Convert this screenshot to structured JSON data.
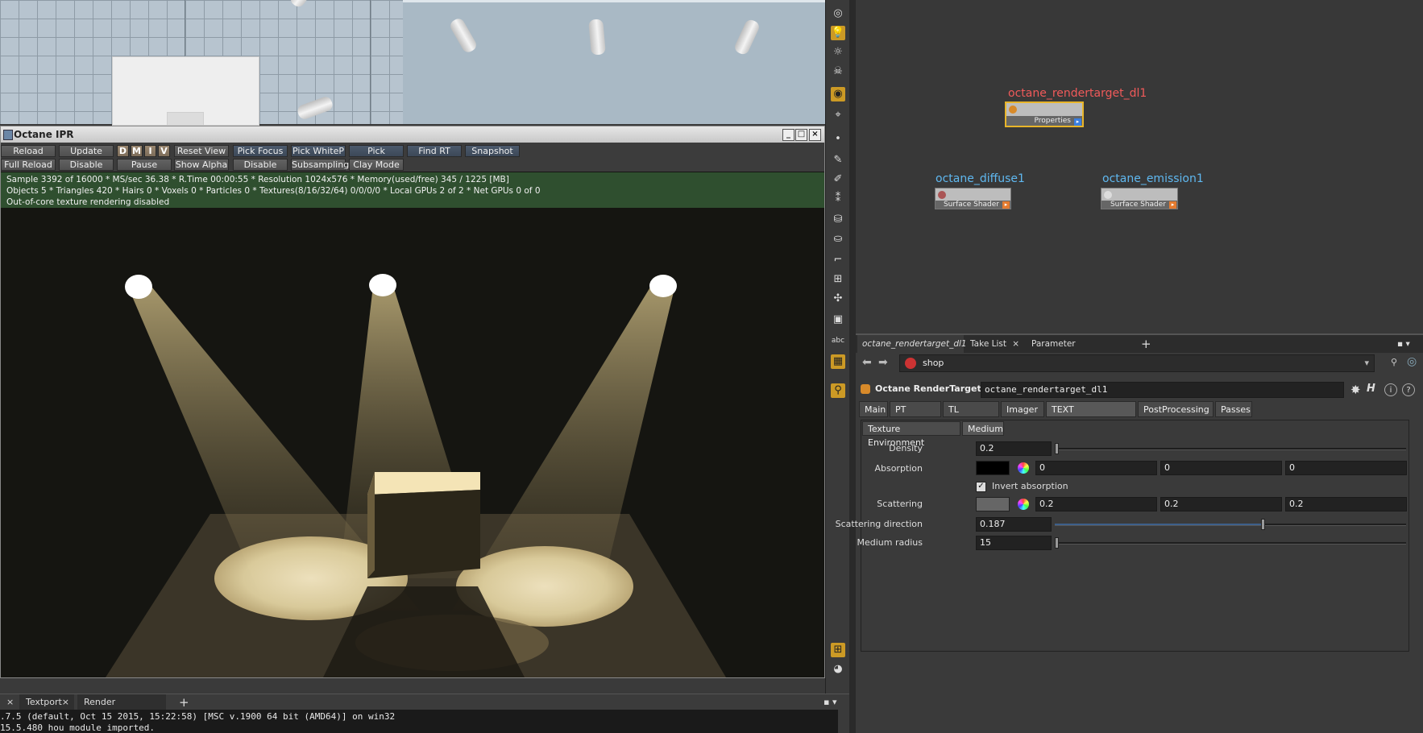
{
  "ipr": {
    "title": "Octane IPR",
    "toolbar_row1": [
      "Reload",
      "Update",
      "D",
      "M",
      "I",
      "V",
      "Reset View",
      "Pick Focus",
      "Pick WhiteP",
      "Pick Material",
      "Find RT",
      "Snapshot"
    ],
    "toolbar_row2": [
      "Full Reload",
      "Disable Upd.",
      "Pause",
      "Show Alpha",
      "Disable DOF",
      "Subsampling",
      "Clay Mode"
    ],
    "status": [
      "Sample 3392 of 16000 * MS/sec 36.38 * R.Time 00:00:55 * Resolution 1024x576 * Memory(used/free) 345 / 1225 [MB]",
      "Objects 5 * Triangles 420 * Hairs 0 * Voxels 0 * Particles 0 * Textures(8/16/32/64) 0/0/0/0 * Local GPUs 2 of 2 * Net GPUs 0 of 0",
      "Out-of-core texture rendering disabled"
    ],
    "window_buttons": [
      "_",
      "□",
      "×"
    ]
  },
  "console": {
    "tabs": [
      "Textport",
      "Render Scheduler"
    ],
    "add": "+",
    "lines": [
      ".7.5 (default, Oct 15 2015, 15:22:58) [MSC v.1900 64 bit (AMD64)] on win32",
      "15.5.480 hou module imported."
    ]
  },
  "network": {
    "nodes": [
      {
        "name": "octane_rendertarget_dl1",
        "band": "Properties",
        "color": "#f05a5a"
      },
      {
        "name": "octane_diffuse1",
        "band": "Surface Shader",
        "color": "#5fb8f0"
      },
      {
        "name": "octane_emission1",
        "band": "Surface Shader",
        "color": "#5fb8f0"
      }
    ]
  },
  "pane": {
    "tabs": [
      "octane_rendertarget_dl1",
      "Take List",
      "Parameter Spreadsheet"
    ],
    "path": "shop",
    "node_type": "Octane RenderTarget",
    "node_name": "octane_rendertarget_dl1",
    "main_tabs": [
      "Main",
      "PT Kernel",
      "TL Camera",
      "Imager",
      "TEXT Environment",
      "PostProcessing",
      "Passes"
    ],
    "sub_tabs": [
      "Texture Environment",
      "Medium"
    ],
    "params": {
      "density_label": "Density",
      "density": "0.2",
      "absorption_label": "Absorption",
      "absorption": [
        "0",
        "0",
        "0"
      ],
      "invert_label": "Invert absorption",
      "scattering_label": "Scattering",
      "scattering": [
        "0.2",
        "0.2",
        "0.2"
      ],
      "scatdir_label": "Scattering direction",
      "scatdir": "0.187",
      "radius_label": "Medium radius",
      "radius": "15"
    }
  }
}
